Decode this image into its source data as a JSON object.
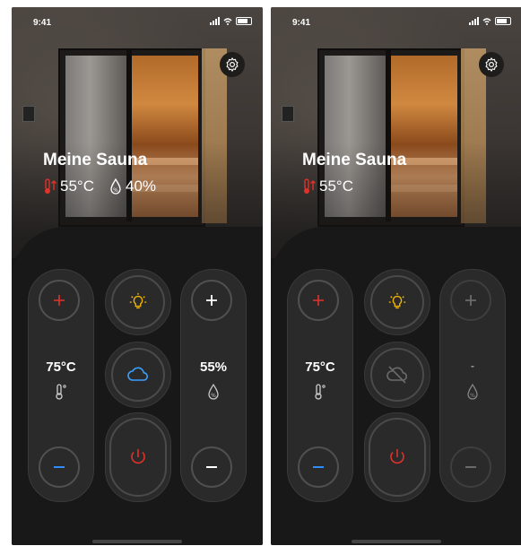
{
  "colors": {
    "accent_blue": "#2f8cff",
    "heat_red": "#e0312a",
    "light_yellow": "#f4b400",
    "cloud_blue": "#3aa0ff",
    "disabled_gray": "#6a6a6a"
  },
  "screens": [
    {
      "status": {
        "time": "9:41"
      },
      "title": "Meine Sauna",
      "temperature_current": "55°C",
      "humidity_current": "40%",
      "temp_control": {
        "value": "75°C",
        "plus_icon": "plus-icon",
        "minus_icon": "minus-icon"
      },
      "humidity_control": {
        "value": "55%",
        "enabled": true
      },
      "light": {
        "on": true,
        "icon": "lightbulb-icon"
      },
      "steam": {
        "on": true,
        "icon": "cloud-icon"
      },
      "power": {
        "icon": "power-icon"
      }
    },
    {
      "status": {
        "time": "9:41"
      },
      "title": "Meine Sauna",
      "temperature_current": "55°C",
      "temp_control": {
        "value": "75°C",
        "plus_icon": "plus-icon",
        "minus_icon": "minus-icon"
      },
      "humidity_control": {
        "value": "-",
        "enabled": false
      },
      "light": {
        "on": true,
        "icon": "lightbulb-icon"
      },
      "steam": {
        "on": false,
        "icon": "cloud-off-icon"
      },
      "power": {
        "icon": "power-icon"
      }
    }
  ]
}
